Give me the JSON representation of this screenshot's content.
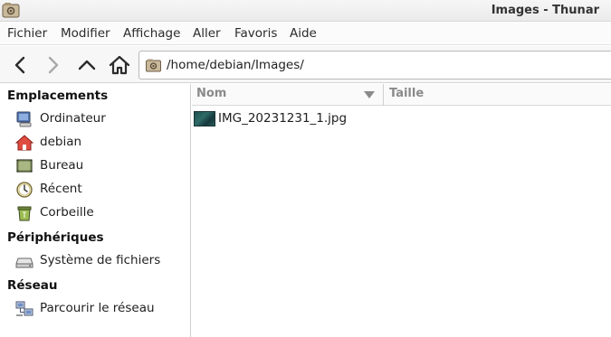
{
  "window": {
    "title": "Images - Thunar"
  },
  "menubar": {
    "items": [
      "Fichier",
      "Modifier",
      "Affichage",
      "Aller",
      "Favoris",
      "Aide"
    ]
  },
  "toolbar": {
    "back_icon": "go-back-icon",
    "forward_icon": "go-forward-icon",
    "up_icon": "go-up-icon",
    "home_icon": "home-icon",
    "location_path": "/home/debian/Images/"
  },
  "sidebar": {
    "sections": [
      {
        "title": "Emplacements",
        "items": [
          {
            "label": "Ordinateur",
            "icon": "computer-icon"
          },
          {
            "label": "debian",
            "icon": "user-home-icon"
          },
          {
            "label": "Bureau",
            "icon": "desktop-icon"
          },
          {
            "label": "Récent",
            "icon": "recent-clock-icon"
          },
          {
            "label": "Corbeille",
            "icon": "trash-icon"
          }
        ]
      },
      {
        "title": "Périphériques",
        "items": [
          {
            "label": "Système de fichiers",
            "icon": "drive-icon"
          }
        ]
      },
      {
        "title": "Réseau",
        "items": [
          {
            "label": "Parcourir le réseau",
            "icon": "network-icon"
          }
        ]
      }
    ]
  },
  "main": {
    "columns": {
      "name": "Nom",
      "size": "Taille"
    },
    "files": [
      {
        "name": "IMG_20231231_1.jpg",
        "icon": "image-thumbnail"
      }
    ]
  },
  "colors": {
    "home_red": "#d9322a",
    "toolbar_bg": "#f7f7f7",
    "column_header_text": "#8a8a8a"
  }
}
